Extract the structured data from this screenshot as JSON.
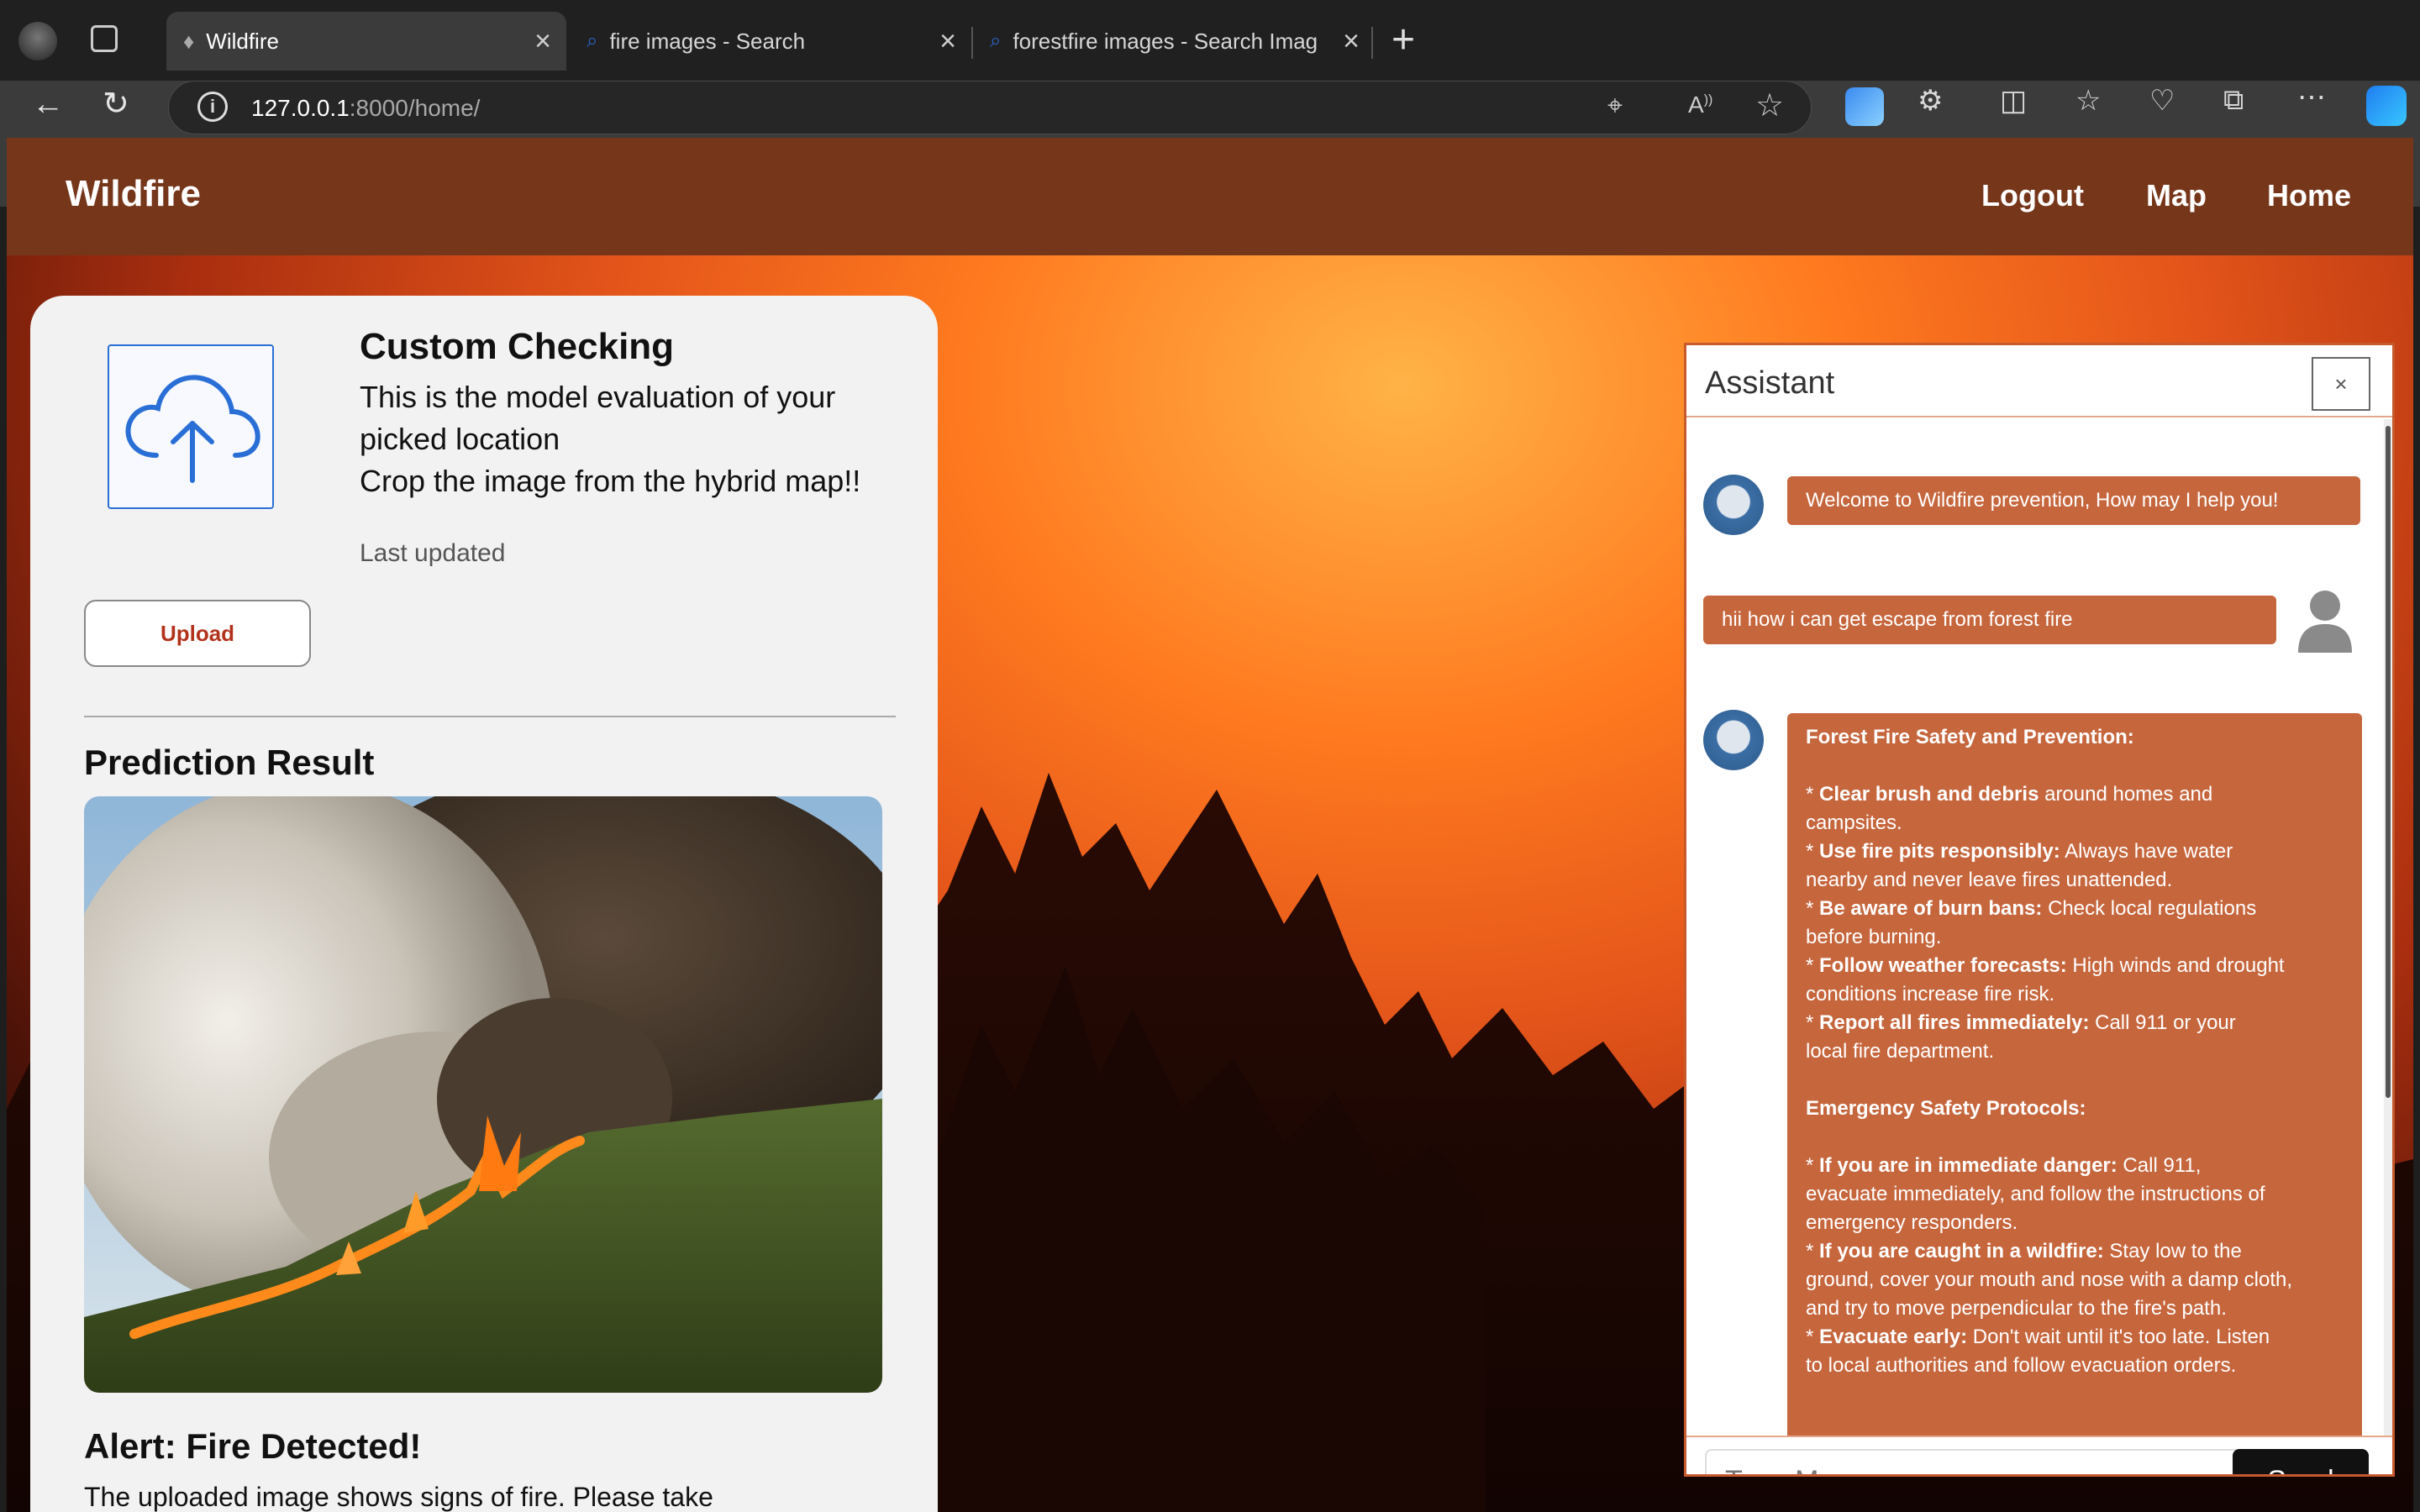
{
  "browser": {
    "tabs": [
      {
        "label": "Wildfire",
        "active": true
      },
      {
        "label": "fire images - Search",
        "active": false
      },
      {
        "label": "forestfire images - Search Imag",
        "active": false
      }
    ],
    "url_host": "127.0.0.1",
    "url_rest": ":8000/home/"
  },
  "navbar": {
    "brand": "Wildfire",
    "links": [
      "Logout",
      "Map",
      "Home"
    ]
  },
  "card": {
    "title": "Custom Checking",
    "desc_line1": "This is the model evaluation of your",
    "desc_line2": "picked location",
    "desc_line3": "Crop the image from the hybrid map!!",
    "last_updated": "Last updated",
    "upload_label": "Upload",
    "prediction_title": "Prediction Result",
    "alert_title": "Alert: Fire Detected!",
    "alert_text": "The uploaded image shows signs of fire. Please take"
  },
  "assistant": {
    "title": "Assistant",
    "close": "×",
    "messages": [
      {
        "from": "bot",
        "text": "Welcome to Wildfire prevention, How may I help you!"
      },
      {
        "from": "user",
        "text": "hii how i can get escape from forest fire"
      }
    ],
    "long_reply": {
      "heading1": "Forest Fire Safety and Prevention:",
      "items1": [
        {
          "bold": "Clear brush and debris",
          "rest1": " around homes and",
          "rest2": "campsites."
        },
        {
          "bold": "Use fire pits responsibly:",
          "rest1": " Always have water",
          "rest2": "nearby and never leave fires unattended."
        },
        {
          "bold": "Be aware of burn bans:",
          "rest1": " Check local regulations",
          "rest2": "before burning."
        },
        {
          "bold": "Follow weather forecasts:",
          "rest1": " High winds and drought",
          "rest2": "conditions increase fire risk."
        },
        {
          "bold": "Report all fires immediately:",
          "rest1": " Call 911 or your",
          "rest2": "local fire department."
        }
      ],
      "heading2": "Emergency Safety Protocols:",
      "items2": [
        {
          "bold": "If you are in immediate danger:",
          "rest1": " Call 911,",
          "rest2": "evacuate immediately, and follow the instructions of",
          "rest3": "emergency responders."
        },
        {
          "bold": "If you are caught in a wildfire:",
          "rest1": " Stay low to the",
          "rest2": "ground, cover your mouth and nose with a damp cloth,",
          "rest3": "and try to move perpendicular to the fire's path."
        },
        {
          "bold": "Evacuate early:",
          "rest1": " Don't wait until it's too late. Listen",
          "rest2": "to local authorities and follow evacuation orders."
        }
      ]
    },
    "input_placeholder": "Type Message ...",
    "send_label": "Send"
  }
}
